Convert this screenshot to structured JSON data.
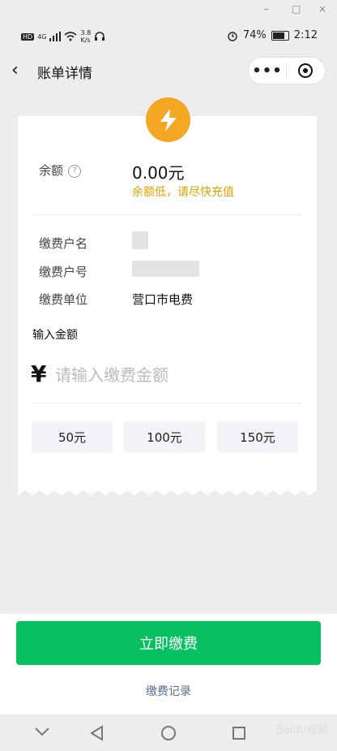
{
  "window": {
    "minimize": "–",
    "maximize": "□",
    "close": "×"
  },
  "status_bar": {
    "net_badge": "HD",
    "net_type": "4G",
    "speed_value": "3.8",
    "speed_unit": "K/s",
    "battery": "74%",
    "time": "2:12"
  },
  "nav": {
    "back_icon": "‹",
    "title": "账单详情",
    "more_icon": "•••"
  },
  "card": {
    "balance_label": "余额",
    "help_icon": "?",
    "balance_value": "0.00元",
    "balance_warning": "余额低，请尽快充值",
    "rows": [
      {
        "label": "缴费户名",
        "value": ""
      },
      {
        "label": "缴费户号",
        "value": ""
      },
      {
        "label": "缴费单位",
        "value": "营口市电费"
      }
    ],
    "amount_title": "输入金额",
    "currency_symbol": "¥",
    "amount_placeholder": "请输入缴费金额",
    "amount_value": "",
    "chips": [
      "50元",
      "100元",
      "150元"
    ]
  },
  "pay_button": "立即缴费",
  "records_link": "缴费记录",
  "watermark": "Baidu经验",
  "colors": {
    "primary_green": "#07c160",
    "warning_orange": "#e0a000",
    "bolt_orange": "#f5a623",
    "link_blue": "#576b95"
  }
}
